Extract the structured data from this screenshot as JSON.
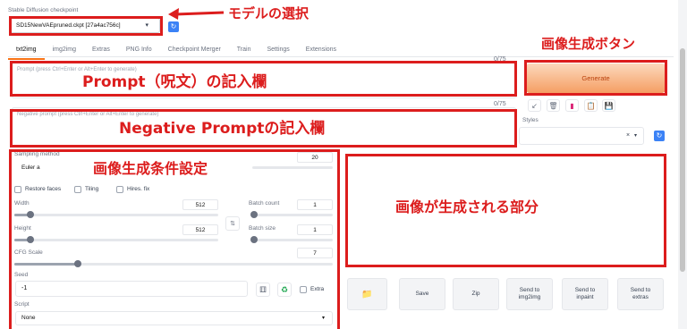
{
  "checkpoint": {
    "label": "Stable Diffusion checkpoint",
    "value": "SD15NewVAEpruned.ckpt [27a4ac756c]",
    "annotation": "モデルの選択"
  },
  "tabs": [
    "txt2img",
    "img2img",
    "Extras",
    "PNG Info",
    "Checkpoint Merger",
    "Train",
    "Settings",
    "Extensions"
  ],
  "prompt": {
    "placeholder": "Prompt (press Ctrl+Enter or Alt+Enter to generate)",
    "counter": "0/75",
    "annotation": "Prompt（呪文）の記入欄"
  },
  "negative_prompt": {
    "placeholder": "Negative prompt (press Ctrl+Enter or Alt+Enter to generate)",
    "counter": "0/75",
    "annotation": "Negative Promptの記入欄"
  },
  "generate": {
    "label": "Generate",
    "annotation": "画像生成ボタン"
  },
  "styles": {
    "label": "Styles",
    "clear": "×"
  },
  "params": {
    "annotation": "画像生成条件設定",
    "sampling_method_label": "Sampling method",
    "sampling_method_value": "Euler a",
    "sampling_steps_value": "20",
    "restore_faces": "Restore faces",
    "tiling": "Tiling",
    "hires_fix": "Hires. fix",
    "width_label": "Width",
    "width_value": "512",
    "width_level": 0.08,
    "height_label": "Height",
    "height_value": "512",
    "height_level": 0.08,
    "batch_count_label": "Batch count",
    "batch_count_value": "1",
    "batch_size_label": "Batch size",
    "batch_size_value": "1",
    "cfg_label": "CFG Scale",
    "cfg_value": "7",
    "cfg_level": 0.2,
    "seed_label": "Seed",
    "seed_value": "-1",
    "extra_label": "Extra",
    "script_label": "Script",
    "script_value": "None"
  },
  "output": {
    "annotation": "画像が生成される部分",
    "buttons": [
      "Save",
      "Zip",
      "Send to img2img",
      "Send to inpaint",
      "Send to extras"
    ]
  },
  "colors": {
    "annotation_red": "#dc1d1d",
    "tab_accent": "#f97316",
    "refresh_blue": "#3b82f6"
  }
}
